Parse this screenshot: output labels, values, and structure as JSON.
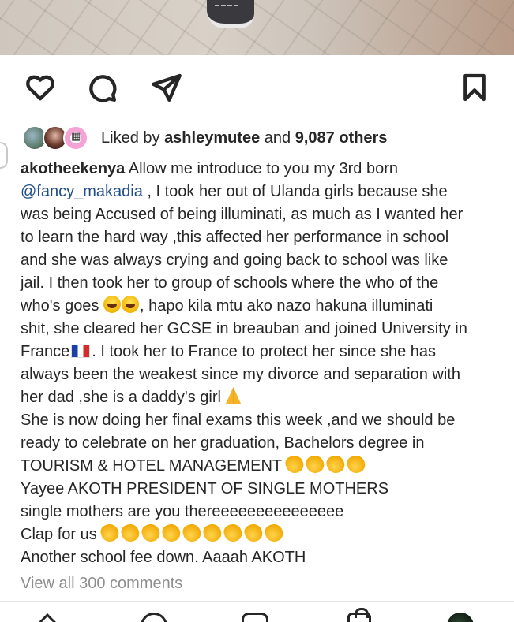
{
  "post": {
    "likes": {
      "prefix": "Liked by",
      "user": "ashleymutee",
      "and": "and",
      "others": "9,087 others"
    },
    "caption": {
      "username": "akotheekenya",
      "mention": "@fancy_makadia",
      "lines": {
        "l1": "Allow me introduce to you my 3rd born",
        "l2": ", I took her out of Ulanda girls because she",
        "l3": "was being Accused of being illuminati, as much as I wanted her",
        "l4": "to learn the hard way ,this affected her performance in school",
        "l5": "and she was always crying and going back to school was like",
        "l6": "jail. I  then took her to group of schools where the who of the",
        "l7a": "who's goes",
        "l7b": ", hapo kila mtu ako nazo hakuna illuminati",
        "l8": "shit, she cleared her GCSE in  breauban and joined University in",
        "l9a": "France",
        "l9b": ". I took her to France to protect her since she has",
        "l10": "always been the weakest since my divorce and separation with",
        "l11": "her dad ,she is a daddy's girl",
        "l12": "She is now doing her final exams this week ,and we should be",
        "l13": "ready to celebrate on her graduation,  Bachelors degree in",
        "l14": "TOURISM & HOTEL MANAGEMENT",
        "l15": "Yayee AKOTH PRESIDENT OF SINGLE MOTHERS",
        "l16": "single mothers are you thereeeeeeeeeeeeeee",
        "l17": "Clap for us",
        "l18": "Another school fee down. Aaaah AKOTH"
      }
    },
    "view_comments": "View all 300 comments"
  },
  "icons": {
    "like": "heart-icon",
    "comment": "comment-icon",
    "share": "paper-plane-icon",
    "save": "bookmark-icon",
    "emoji_laugh": "rolling-on-floor-laughing-emoji",
    "emoji_pray": "folded-hands-emoji",
    "emoji_clap": "clapping-hands-emoji",
    "flag": "france-flag-emoji"
  },
  "colors": {
    "text": "#262626",
    "muted": "#8e8e8e",
    "mention": "#1f4e89"
  }
}
